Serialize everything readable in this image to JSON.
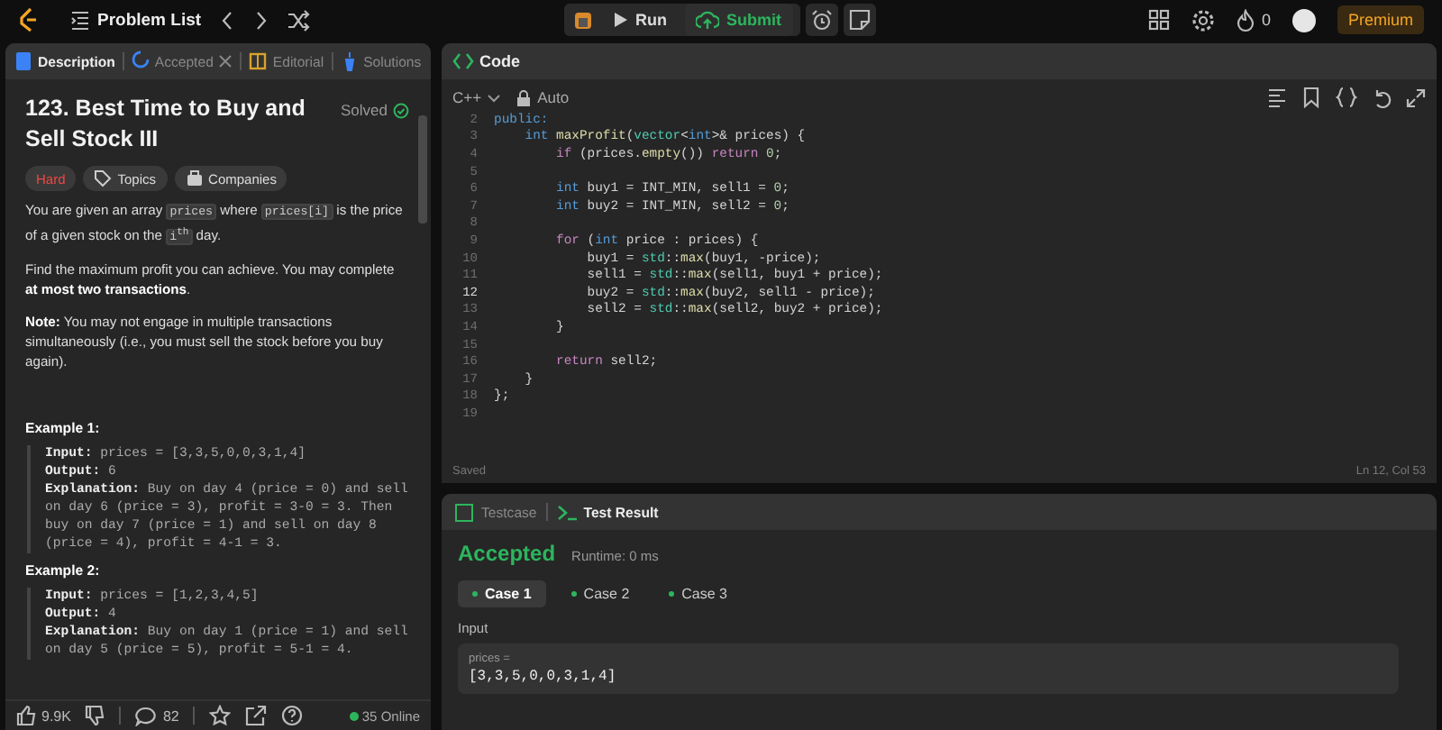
{
  "topbar": {
    "problem_list": "Problem List",
    "run": "Run",
    "submit": "Submit",
    "streak": "0",
    "premium": "Premium"
  },
  "left_tabs": [
    {
      "label": "Description",
      "selected": true,
      "kind": "description"
    },
    {
      "label": "Accepted",
      "selected": false,
      "kind": "accepted"
    },
    {
      "label": "Editorial",
      "selected": false,
      "kind": "editorial"
    },
    {
      "label": "Solutions",
      "selected": false,
      "kind": "solutions"
    }
  ],
  "problem": {
    "title": "123. Best Time to Buy and Sell Stock III",
    "status": "Solved",
    "tags": [
      {
        "label": "Hard",
        "kind": "difficulty"
      },
      {
        "label": "Topics",
        "kind": "topics"
      },
      {
        "label": "Companies",
        "kind": "companies"
      }
    ],
    "paragraphs": [
      [
        {
          "kind": "text",
          "text": "You are given an array "
        },
        {
          "kind": "code",
          "text": "prices"
        },
        {
          "kind": "text",
          "text": " where "
        },
        {
          "kind": "code",
          "text": "prices[i]"
        },
        {
          "kind": "text",
          "text": " is the price of a given stock on the "
        },
        {
          "kind": "code",
          "text": "i$^{th}$"
        },
        {
          "kind": "text",
          "text": " day."
        }
      ],
      [
        {
          "kind": "text",
          "text": "Find the maximum profit you can achieve. You may complete **at most two transactions**."
        }
      ],
      [
        {
          "kind": "text",
          "text": "**Note:** You may not engage in multiple transactions simultaneously (i.e., you must sell the stock before you buy again)."
        }
      ]
    ],
    "examples": [
      {
        "title": "Example 1:",
        "lines": [
          "**Input:** prices = [3,3,5,0,0,3,1,4]",
          "**Output:** 6",
          "**Explanation:** Buy on day 4 (price = 0) and sell on day 6 (price = 3), profit = 3-0 = 3. Then buy on day 7 (price = 1) and sell on day 8 (price = 4), profit = 4-1 = 3."
        ]
      },
      {
        "title": "Example 2:",
        "lines": [
          "**Input:** prices = [1,2,3,4,5]",
          "**Output:** 4",
          "**Explanation:** Buy on day 1 (price = 1) and sell on day 5 (price = 5), profit = 5-1 = 4."
        ]
      }
    ]
  },
  "left_footer": {
    "likes": "9.9K",
    "comments": "82",
    "online": "35 Online"
  },
  "editor": {
    "title": "Code",
    "language": "C++",
    "mode": "Auto",
    "lines": [
      {
        "number": "2",
        "current": false,
        "tokens": [
          {
            "kind": "type",
            "text": "public:"
          }
        ]
      },
      {
        "number": "3",
        "current": false,
        "tokens": [
          {
            "kind": "type",
            "text": "    int"
          },
          {
            "kind": "fn",
            "text": " maxProfit"
          },
          {
            "kind": "plain",
            "text": "("
          },
          {
            "kind": "ns",
            "text": "vector"
          },
          {
            "kind": "plain",
            "text": "<"
          },
          {
            "kind": "type",
            "text": "int"
          },
          {
            "kind": "plain",
            "text": ">& prices) {"
          }
        ]
      },
      {
        "number": "4",
        "current": false,
        "tokens": [
          {
            "kind": "kw",
            "text": "        if"
          },
          {
            "kind": "plain",
            "text": " (prices."
          },
          {
            "kind": "fn",
            "text": "empty"
          },
          {
            "kind": "plain",
            "text": "()) "
          },
          {
            "kind": "kw",
            "text": "return"
          },
          {
            "kind": "num",
            "text": " 0"
          },
          {
            "kind": "plain",
            "text": ";"
          }
        ]
      },
      {
        "number": "5",
        "current": false
      },
      {
        "number": "6",
        "current": false,
        "tokens": [
          {
            "kind": "type",
            "text": "        int"
          },
          {
            "kind": "plain",
            "text": " buy1 = INT_MIN, sell1 = "
          },
          {
            "kind": "num",
            "text": "0"
          },
          {
            "kind": "plain",
            "text": ";"
          }
        ]
      },
      {
        "number": "7",
        "current": false,
        "tokens": [
          {
            "kind": "type",
            "text": "        int"
          },
          {
            "kind": "plain",
            "text": " buy2 = INT_MIN, sell2 = "
          },
          {
            "kind": "num",
            "text": "0"
          },
          {
            "kind": "plain",
            "text": ";"
          }
        ]
      },
      {
        "number": "8",
        "current": false
      },
      {
        "number": "9",
        "current": false,
        "tokens": [
          {
            "kind": "kw",
            "text": "        for"
          },
          {
            "kind": "plain",
            "text": " ("
          },
          {
            "kind": "type",
            "text": "int"
          },
          {
            "kind": "plain",
            "text": " price : prices) {"
          }
        ]
      },
      {
        "number": "10",
        "current": false,
        "tokens": [
          {
            "kind": "plain",
            "text": "            buy1 = "
          },
          {
            "kind": "ns",
            "text": "std"
          },
          {
            "kind": "plain",
            "text": "::"
          },
          {
            "kind": "fn",
            "text": "max"
          },
          {
            "kind": "plain",
            "text": "(buy1, -price);"
          }
        ]
      },
      {
        "number": "11",
        "current": false,
        "tokens": [
          {
            "kind": "plain",
            "text": "            sell1 = "
          },
          {
            "kind": "ns",
            "text": "std"
          },
          {
            "kind": "plain",
            "text": "::"
          },
          {
            "kind": "fn",
            "text": "max"
          },
          {
            "kind": "plain",
            "text": "(sell1, buy1 + price);"
          }
        ]
      },
      {
        "number": "12",
        "current": true,
        "tokens": [
          {
            "kind": "plain",
            "text": "            buy2 = "
          },
          {
            "kind": "ns",
            "text": "std"
          },
          {
            "kind": "plain",
            "text": "::"
          },
          {
            "kind": "fn",
            "text": "max"
          },
          {
            "kind": "plain",
            "text": "(buy2, sell1 - price);"
          }
        ]
      },
      {
        "number": "13",
        "current": false,
        "tokens": [
          {
            "kind": "plain",
            "text": "            sell2 = "
          },
          {
            "kind": "ns",
            "text": "std"
          },
          {
            "kind": "plain",
            "text": "::"
          },
          {
            "kind": "fn",
            "text": "max"
          },
          {
            "kind": "plain",
            "text": "(sell2, buy2 + price);"
          }
        ]
      },
      {
        "number": "14",
        "current": false,
        "tokens": [
          {
            "kind": "plain",
            "text": "        }"
          }
        ]
      },
      {
        "number": "15",
        "current": false
      },
      {
        "number": "16",
        "current": false,
        "tokens": [
          {
            "kind": "kw",
            "text": "        return"
          },
          {
            "kind": "plain",
            "text": " sell2;"
          }
        ]
      },
      {
        "number": "17",
        "current": false,
        "tokens": [
          {
            "kind": "plain",
            "text": "    }"
          }
        ]
      },
      {
        "number": "18",
        "current": false,
        "tokens": [
          {
            "kind": "plain",
            "text": "};"
          }
        ]
      },
      {
        "number": "19",
        "current": false
      }
    ],
    "status": "Saved",
    "cursor": "Ln 12, Col 53"
  },
  "bottom_tabs": [
    {
      "label": "Testcase",
      "selected": false
    },
    {
      "label": "Test Result",
      "selected": true
    }
  ],
  "result": {
    "verdict": "Accepted",
    "runtime": "Runtime: 0 ms",
    "cases": [
      {
        "label": "Case 1",
        "selected": true
      },
      {
        "label": "Case 2",
        "selected": false
      },
      {
        "label": "Case 3",
        "selected": false
      }
    ],
    "input_label": "Input",
    "param_name": "prices =",
    "param_value": "[3,3,5,0,0,3,1,4]"
  }
}
